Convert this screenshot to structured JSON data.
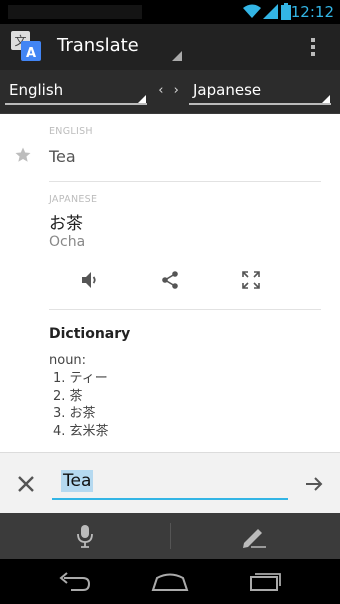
{
  "status_bar": {
    "time": "12:12"
  },
  "action_bar": {
    "title": "Translate",
    "icons": {
      "app": "translate-app-icon",
      "overflow": "overflow-menu-icon"
    }
  },
  "language_bar": {
    "source_language": "English",
    "target_language": "Japanese",
    "swap_icon": "swap-languages-icon"
  },
  "result": {
    "source_label": "ENGLISH",
    "source_text": "Tea",
    "target_label": "JAPANESE",
    "target_text": "お茶",
    "target_romanization": "Ocha",
    "actions": [
      "speaker-icon",
      "share-icon",
      "fullscreen-icon"
    ]
  },
  "dictionary": {
    "title": "Dictionary",
    "part_of_speech": "noun:",
    "entries": [
      "1. ティー",
      "2. 茶",
      "3. お茶",
      "4. 玄米茶"
    ]
  },
  "input": {
    "value": "Tea"
  },
  "bottom_tools": [
    "microphone-icon",
    "handwriting-pen-icon"
  ],
  "nav_bar": [
    "back-icon",
    "home-icon",
    "recent-apps-icon"
  ],
  "colors": {
    "accent": "#33b5e5",
    "actionbar": "#222222",
    "langbar": "#2c2c2c",
    "toolbar": "#3b3b3b"
  }
}
